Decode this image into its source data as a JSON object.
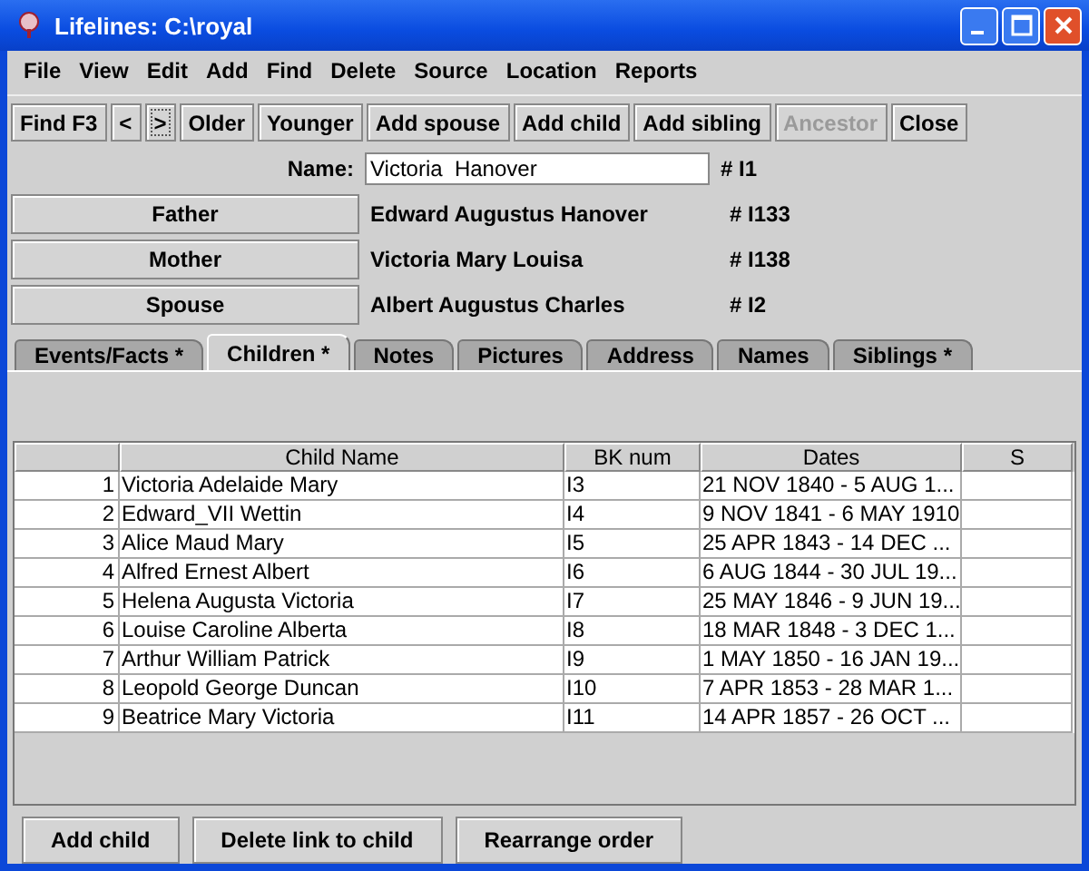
{
  "window": {
    "title": "Lifelines: C:\\royal"
  },
  "menu": [
    "File",
    "View",
    "Edit",
    "Add",
    "Find",
    "Delete",
    "Source",
    "Location",
    "Reports"
  ],
  "toolbar": [
    {
      "label": "Find F3",
      "disabled": false,
      "focused": false
    },
    {
      "label": "<",
      "disabled": false,
      "focused": false
    },
    {
      "label": ">",
      "disabled": false,
      "focused": true
    },
    {
      "label": "Older",
      "disabled": false,
      "focused": false
    },
    {
      "label": "Younger",
      "disabled": false,
      "focused": false
    },
    {
      "label": "Add spouse",
      "disabled": false,
      "focused": false
    },
    {
      "label": "Add child",
      "disabled": false,
      "focused": false
    },
    {
      "label": "Add sibling",
      "disabled": false,
      "focused": false
    },
    {
      "label": "Ancestor",
      "disabled": true,
      "focused": false
    },
    {
      "label": "Close",
      "disabled": false,
      "focused": false
    }
  ],
  "name_field": {
    "label": "Name:",
    "value": "Victoria  Hanover",
    "id": "# I1"
  },
  "relatives": [
    {
      "button": "Father",
      "name": "Edward Augustus Hanover",
      "id": "# I133"
    },
    {
      "button": "Mother",
      "name": "Victoria Mary Louisa",
      "id": "# I138"
    },
    {
      "button": "Spouse",
      "name": "Albert Augustus Charles",
      "id": "# I2"
    }
  ],
  "tabs": [
    {
      "label": "Events/Facts *",
      "selected": false
    },
    {
      "label": "Children *",
      "selected": true
    },
    {
      "label": "Notes",
      "selected": false
    },
    {
      "label": "Pictures",
      "selected": false
    },
    {
      "label": "Address",
      "selected": false
    },
    {
      "label": "Names",
      "selected": false
    },
    {
      "label": "Siblings *",
      "selected": false
    }
  ],
  "table": {
    "columns": [
      "Child Name",
      "BK num",
      "Dates",
      "S"
    ],
    "rows": [
      {
        "number": "1",
        "name": "Victoria Adelaide Mary",
        "bk": "I3",
        "dates": "21 NOV 1840 - 5 AUG 1..."
      },
      {
        "number": "2",
        "name": "Edward_VII  Wettin",
        "bk": "I4",
        "dates": "9 NOV 1841 - 6 MAY 1910"
      },
      {
        "number": "3",
        "name": "Alice Maud Mary",
        "bk": "I5",
        "dates": "25 APR 1843 - 14 DEC ..."
      },
      {
        "number": "4",
        "name": "Alfred Ernest Albert",
        "bk": "I6",
        "dates": "6 AUG 1844 - 30 JUL 19..."
      },
      {
        "number": "5",
        "name": "Helena Augusta Victoria",
        "bk": "I7",
        "dates": "25 MAY 1846 - 9 JUN 19..."
      },
      {
        "number": "6",
        "name": "Louise Caroline Alberta",
        "bk": "I8",
        "dates": "18 MAR 1848 - 3 DEC 1..."
      },
      {
        "number": "7",
        "name": "Arthur William Patrick",
        "bk": "I9",
        "dates": "1 MAY 1850 - 16 JAN 19..."
      },
      {
        "number": "8",
        "name": "Leopold George Duncan",
        "bk": "I10",
        "dates": "7 APR 1853 - 28 MAR 1..."
      },
      {
        "number": "9",
        "name": "Beatrice Mary Victoria",
        "bk": "I11",
        "dates": "14 APR 1857 - 26 OCT ..."
      }
    ]
  },
  "bottom_buttons": [
    "Add child",
    "Delete link to child",
    "Rearrange order"
  ]
}
